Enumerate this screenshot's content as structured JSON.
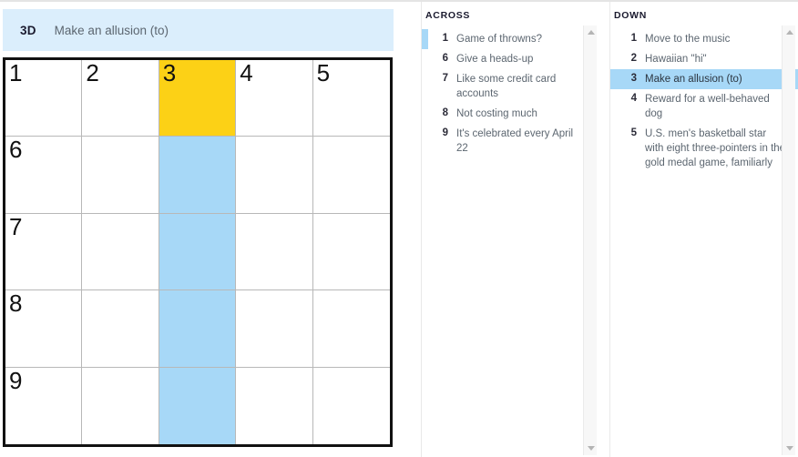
{
  "current_clue": {
    "number": "3D",
    "text": "Make an allusion (to)"
  },
  "grid": {
    "rows": 5,
    "cols": 5,
    "focus_color": "#fcd116",
    "word_color": "#a7d8f7",
    "cells": [
      {
        "num": "1",
        "letter": "",
        "state": "normal"
      },
      {
        "num": "2",
        "letter": "",
        "state": "normal"
      },
      {
        "num": "3",
        "letter": "",
        "state": "focus"
      },
      {
        "num": "4",
        "letter": "",
        "state": "normal"
      },
      {
        "num": "5",
        "letter": "",
        "state": "normal"
      },
      {
        "num": "6",
        "letter": "",
        "state": "normal"
      },
      {
        "num": "",
        "letter": "",
        "state": "normal"
      },
      {
        "num": "",
        "letter": "",
        "state": "word"
      },
      {
        "num": "",
        "letter": "",
        "state": "normal"
      },
      {
        "num": "",
        "letter": "",
        "state": "normal"
      },
      {
        "num": "7",
        "letter": "",
        "state": "normal"
      },
      {
        "num": "",
        "letter": "",
        "state": "normal"
      },
      {
        "num": "",
        "letter": "",
        "state": "word"
      },
      {
        "num": "",
        "letter": "",
        "state": "normal"
      },
      {
        "num": "",
        "letter": "",
        "state": "normal"
      },
      {
        "num": "8",
        "letter": "",
        "state": "normal"
      },
      {
        "num": "",
        "letter": "",
        "state": "normal"
      },
      {
        "num": "",
        "letter": "",
        "state": "word"
      },
      {
        "num": "",
        "letter": "",
        "state": "normal"
      },
      {
        "num": "",
        "letter": "",
        "state": "normal"
      },
      {
        "num": "9",
        "letter": "",
        "state": "normal"
      },
      {
        "num": "",
        "letter": "",
        "state": "normal"
      },
      {
        "num": "",
        "letter": "",
        "state": "word"
      },
      {
        "num": "",
        "letter": "",
        "state": "normal"
      },
      {
        "num": "",
        "letter": "",
        "state": "normal"
      }
    ]
  },
  "across": {
    "title": "ACROSS",
    "clues": [
      {
        "num": "1",
        "text": "Game of throwns?",
        "state": "cursor"
      },
      {
        "num": "6",
        "text": "Give a heads-up",
        "state": "normal"
      },
      {
        "num": "7",
        "text": "Like some credit card accounts",
        "state": "normal"
      },
      {
        "num": "8",
        "text": "Not costing much",
        "state": "normal"
      },
      {
        "num": "9",
        "text": "It's celebrated every April 22",
        "state": "normal"
      }
    ]
  },
  "down": {
    "title": "DOWN",
    "clues": [
      {
        "num": "1",
        "text": "Move to the music",
        "state": "normal"
      },
      {
        "num": "2",
        "text": "Hawaiian \"hi\"",
        "state": "normal"
      },
      {
        "num": "3",
        "text": "Make an allusion (to)",
        "state": "selected"
      },
      {
        "num": "4",
        "text": "Reward for a well-behaved dog",
        "state": "normal"
      },
      {
        "num": "5",
        "text": "U.S. men's basketball star with eight three-pointers in the gold medal game, familiarly",
        "state": "normal"
      }
    ]
  },
  "scrollbars": {
    "across": {
      "arrow_up": "scroll-up-arrow",
      "arrow_down": "scroll-down-arrow"
    },
    "down": {
      "arrow_up": "scroll-up-arrow",
      "arrow_down": "scroll-down-arrow"
    }
  }
}
